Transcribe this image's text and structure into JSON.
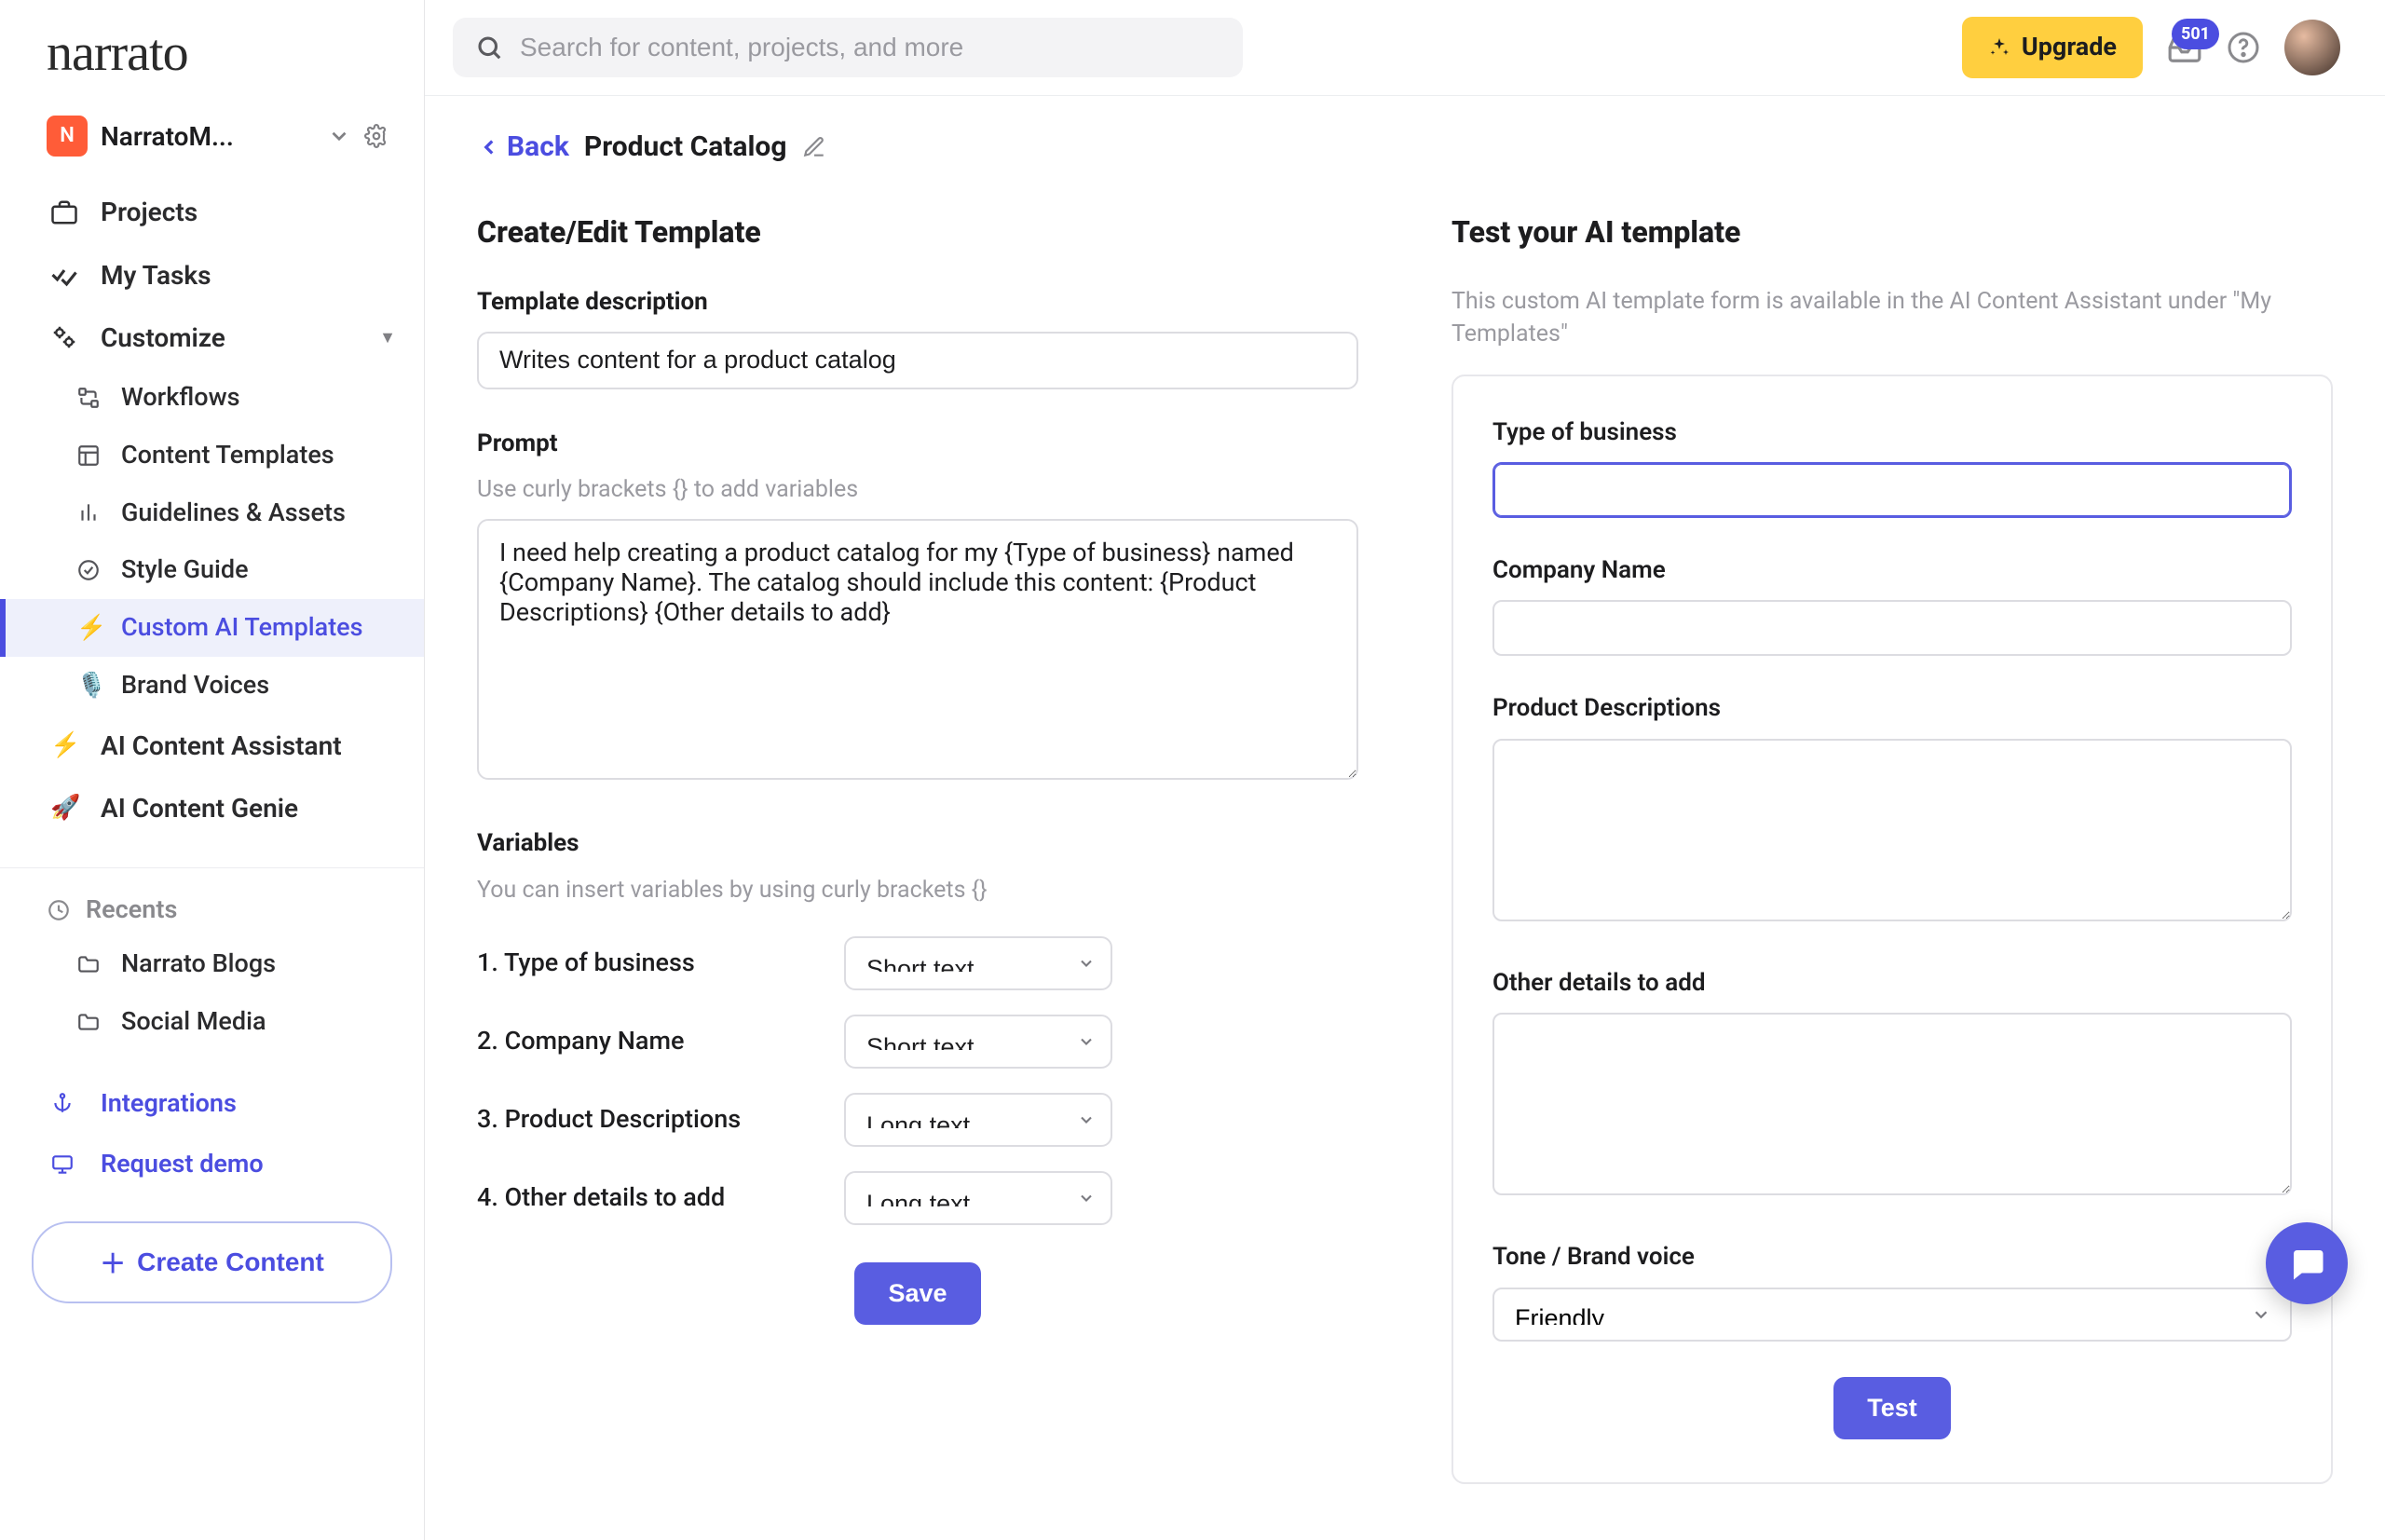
{
  "brand": {
    "name": "narrato"
  },
  "workspace": {
    "initial": "N",
    "name": "NarratoM..."
  },
  "sidebar": {
    "projects": "Projects",
    "my_tasks": "My Tasks",
    "customize": "Customize",
    "sub": {
      "workflows": "Workflows",
      "content_templates": "Content Templates",
      "guidelines": "Guidelines & Assets",
      "style_guide": "Style Guide",
      "custom_ai": "Custom AI Templates",
      "brand_voices": "Brand Voices"
    },
    "ai_assistant": "AI Content Assistant",
    "ai_genie": "AI Content Genie",
    "recents_label": "Recents",
    "recents": [
      "Narrato Blogs",
      "Social Media"
    ],
    "integrations": "Integrations",
    "request_demo": "Request demo",
    "create_content": "Create Content"
  },
  "topbar": {
    "search_placeholder": "Search for content, projects, and more",
    "upgrade": "Upgrade",
    "notification_count": "501"
  },
  "crumb": {
    "back": "Back",
    "title": "Product Catalog"
  },
  "left": {
    "section_title": "Create/Edit Template",
    "desc_label": "Template description",
    "desc_value": "Writes content for a product catalog",
    "prompt_label": "Prompt",
    "prompt_hint": "Use curly brackets {} to add variables",
    "prompt_value": "I need help creating a product catalog for my {Type of business} named {Company Name}. The catalog should include this content: {Product Descriptions} {Other details to add}",
    "vars_label": "Variables",
    "vars_hint": "You can insert variables by using curly brackets {}",
    "variables": [
      {
        "idx": "1.",
        "name": "Type of business",
        "type": "Short text"
      },
      {
        "idx": "2.",
        "name": "Company Name",
        "type": "Short text"
      },
      {
        "idx": "3.",
        "name": "Product Descriptions",
        "type": "Long text"
      },
      {
        "idx": "4.",
        "name": "Other details to add",
        "type": "Long text"
      }
    ],
    "save": "Save"
  },
  "right": {
    "section_title": "Test your AI template",
    "note": "This custom AI template form is available in the AI Content Assistant under \"My Templates\"",
    "fields": {
      "type_of_business": "Type of business",
      "company_name": "Company Name",
      "product_descriptions": "Product Descriptions",
      "other_details": "Other details to add",
      "tone_label": "Tone / Brand voice",
      "tone_value": "Friendly"
    },
    "test": "Test"
  }
}
